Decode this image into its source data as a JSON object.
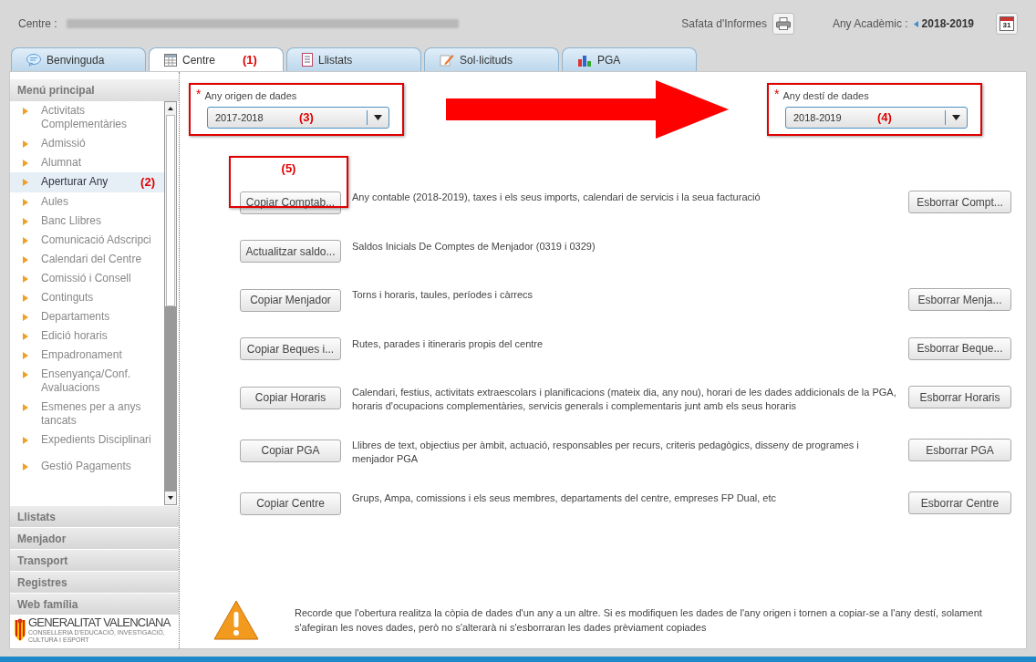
{
  "header": {
    "centre_label": "Centre :",
    "reports_label": "Safata d'Informes",
    "year_label": "Any Acadèmic :",
    "year": "2018-2019",
    "calendar_day": "31"
  },
  "tabs": [
    {
      "label": "Benvinguda",
      "selected": false
    },
    {
      "label": "Centre",
      "selected": true,
      "note": "(1)"
    },
    {
      "label": "Llistats",
      "selected": false
    },
    {
      "label": "Sol·licituds",
      "selected": false
    },
    {
      "label": "PGA",
      "selected": false
    }
  ],
  "sidebar": {
    "title": "Menú principal",
    "items": [
      {
        "label": "Activitats Complementàries",
        "selected": false
      },
      {
        "label": "Admissió",
        "selected": false
      },
      {
        "label": "Alumnat",
        "selected": false
      },
      {
        "label": "Aperturar Any",
        "selected": true,
        "note": "(2)"
      },
      {
        "label": "Aules",
        "selected": false
      },
      {
        "label": "Banc Llibres",
        "selected": false
      },
      {
        "label": "Comunicació Adscripci",
        "selected": false
      },
      {
        "label": "Calendari del Centre",
        "selected": false
      },
      {
        "label": "Comissió i Consell",
        "selected": false
      },
      {
        "label": "Continguts",
        "selected": false
      },
      {
        "label": "Departaments",
        "selected": false
      },
      {
        "label": "Edició horaris",
        "selected": false
      },
      {
        "label": "Empadronament",
        "selected": false
      },
      {
        "label": "Ensenyança/Conf. Avaluacions",
        "selected": false
      },
      {
        "label": "Esmenes per a anys tancats",
        "selected": false
      },
      {
        "label": "Expedients Disciplinari",
        "selected": false
      },
      {
        "label": "Gestió Pagaments",
        "selected": false
      }
    ],
    "sections": [
      "Llistats",
      "Menjador",
      "Transport",
      "Registres",
      "Web família"
    ],
    "logo": {
      "title": "GENERALITAT VALENCIANA",
      "subtitle": "CONSELLERIA D'EDUCACIÓ, INVESTIGACIÓ, CULTURA I ESPORT"
    }
  },
  "source": {
    "required_mark": "*",
    "label": "Any origen de dades",
    "value": "2017-2018",
    "note": "(3)"
  },
  "target": {
    "required_mark": "*",
    "label": "Any destí de dades",
    "value": "2018-2019",
    "note": "(4)"
  },
  "actions": [
    {
      "copy": "Copiar Comptab...",
      "description": "Any contable (2018-2019), taxes i els seus imports, calendari de servicis i la seua facturació",
      "delete": "Esborrar Compt...",
      "note": "(5)"
    },
    {
      "copy": "Actualitzar saldo...",
      "description": "Saldos Inicials De Comptes de Menjador (0319 i 0329)"
    },
    {
      "copy": "Copiar Menjador",
      "description": "Torns i horaris, taules, períodes i càrrecs",
      "delete": "Esborrar Menja..."
    },
    {
      "copy": "Copiar Beques i...",
      "description": "Rutes, parades i itineraris propis del centre",
      "delete": "Esborrar Beque..."
    },
    {
      "copy": "Copiar Horaris",
      "description": "Calendari, festius, activitats extraescolars i planificacions (mateix dia, any nou), horari de les dades addicionals de la PGA, horaris d'ocupacions complementàries, servicis generals i complementaris junt amb els seus horaris",
      "delete": "Esborrar Horaris"
    },
    {
      "copy": "Copiar PGA",
      "description": "Llibres de text, objectius per àmbit, actuació, responsables per recurs, criteris pedagògics, disseny de programes i menjador PGA",
      "delete": "Esborrar PGA"
    },
    {
      "copy": "Copiar Centre",
      "description": "Grups, Ampa, comissions i els seus membres, departaments del centre, empreses FP Dual, etc",
      "delete": "Esborrar Centre"
    }
  ],
  "warning": "Recorde que l'obertura realitza la còpia de dades d'un any a un altre. Si es modifiquen les dades de l'any origen i tornen a copiar-se a l'any destí, solament s'afegiran les noves dades, però no s'alterarà ni s'esborraran les dades prèviament copiades"
}
